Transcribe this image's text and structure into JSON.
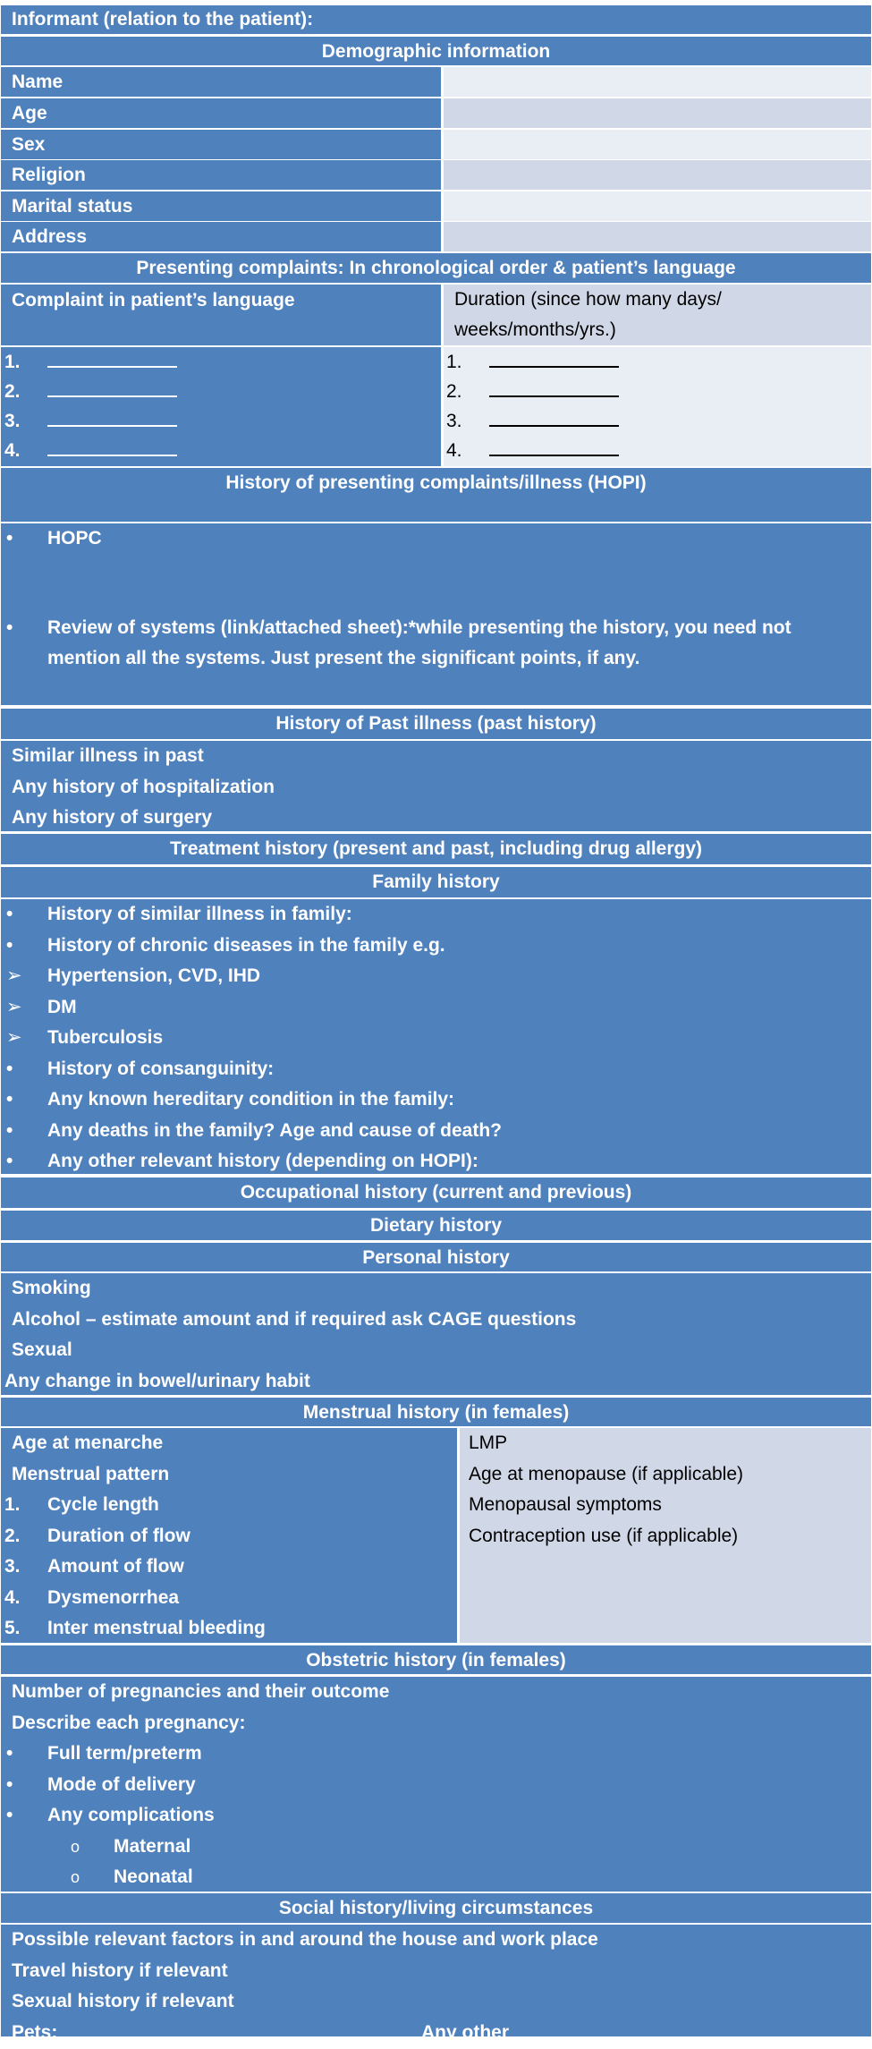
{
  "colors": {
    "header_bg": "#4F81BD",
    "light_cell": "#E9EDF4",
    "mid_cell": "#D0D8E8",
    "text_light": "#FFFFFF"
  },
  "informant": "Informant (relation to the patient):",
  "demographic": {
    "title": "Demographic information",
    "fields": [
      "Name",
      "Age",
      "Sex",
      "Religion",
      "Marital status",
      "Address"
    ]
  },
  "presenting": {
    "title": "Presenting complaints: In chronological order & patient’s language",
    "complaint_header": "Complaint in patient’s language",
    "duration_header_line1": "Duration (since how many days/",
    "duration_header_line2": "weeks/months/yrs.)",
    "numbers": [
      "1.",
      "2.",
      "3.",
      "4."
    ],
    "blank": "____________"
  },
  "hopi": {
    "title": "History of presenting complaints/illness (HOPI)",
    "bullet": "•",
    "item1": "HOPC",
    "item2_line1": "Review of systems (link/attached sheet):*while presenting the history, you need not",
    "item2_line2": "mention all the systems. Just present the significant points, if any."
  },
  "past": {
    "title": "History of Past illness (past history)",
    "items": [
      "Similar illness in past",
      "Any history of hospitalization",
      "Any history of surgery"
    ]
  },
  "treatment": {
    "title": "Treatment history (present and past, including drug allergy)"
  },
  "family": {
    "title": "Family history",
    "items": [
      {
        "marker": "•",
        "text": "History of similar illness in family:"
      },
      {
        "marker": "•",
        "text": "History of chronic diseases in the family e.g."
      },
      {
        "marker": "➢",
        "text": "Hypertension, CVD, IHD"
      },
      {
        "marker": "➢",
        "text": "DM"
      },
      {
        "marker": "➢",
        "text": "Tuberculosis"
      },
      {
        "marker": "•",
        "text": "History of consanguinity:"
      },
      {
        "marker": "•",
        "text": "Any known hereditary condition in the family:"
      },
      {
        "marker": "•",
        "text": "Any deaths in the family? Age and cause of death?"
      },
      {
        "marker": "•",
        "text": "Any other relevant history (depending on HOPI):"
      }
    ]
  },
  "occupational": {
    "title": "Occupational history (current and previous)"
  },
  "dietary": {
    "title": "Dietary history"
  },
  "personal": {
    "title": "Personal history",
    "items": [
      "Smoking",
      "Alcohol – estimate amount and if required ask CAGE questions",
      "Sexual",
      "Any change in bowel/urinary habit"
    ]
  },
  "menstrual": {
    "title": "Menstrual history (in females)",
    "left": [
      "Age at menarche",
      "Menstrual pattern"
    ],
    "pattern_items": [
      {
        "num": "1.",
        "text": "Cycle length"
      },
      {
        "num": "2.",
        "text": "Duration of flow"
      },
      {
        "num": "3.",
        "text": "Amount of flow"
      },
      {
        "num": "4.",
        "text": "Dysmenorrhea"
      },
      {
        "num": "5.",
        "text": "Inter menstrual bleeding"
      }
    ],
    "right": [
      "LMP",
      "Age at menopause (if applicable)",
      "Menopausal symptoms",
      "Contraception use (if applicable)"
    ]
  },
  "obstetric": {
    "title": "Obstetric history (in females)",
    "items": [
      "Number of pregnancies and their outcome",
      "Describe each pregnancy:"
    ],
    "bullets": [
      "Full term/preterm",
      "Mode of delivery",
      "Any complications"
    ],
    "sub_marker": "o",
    "sub_items": [
      "Maternal",
      "Neonatal"
    ]
  },
  "social": {
    "title": "Social history/living circumstances",
    "items": [
      "Possible relevant factors in and around the house and work place",
      "Travel history if relevant",
      "Sexual history if relevant"
    ],
    "pets": "Pets:",
    "any_other": "Any other"
  }
}
